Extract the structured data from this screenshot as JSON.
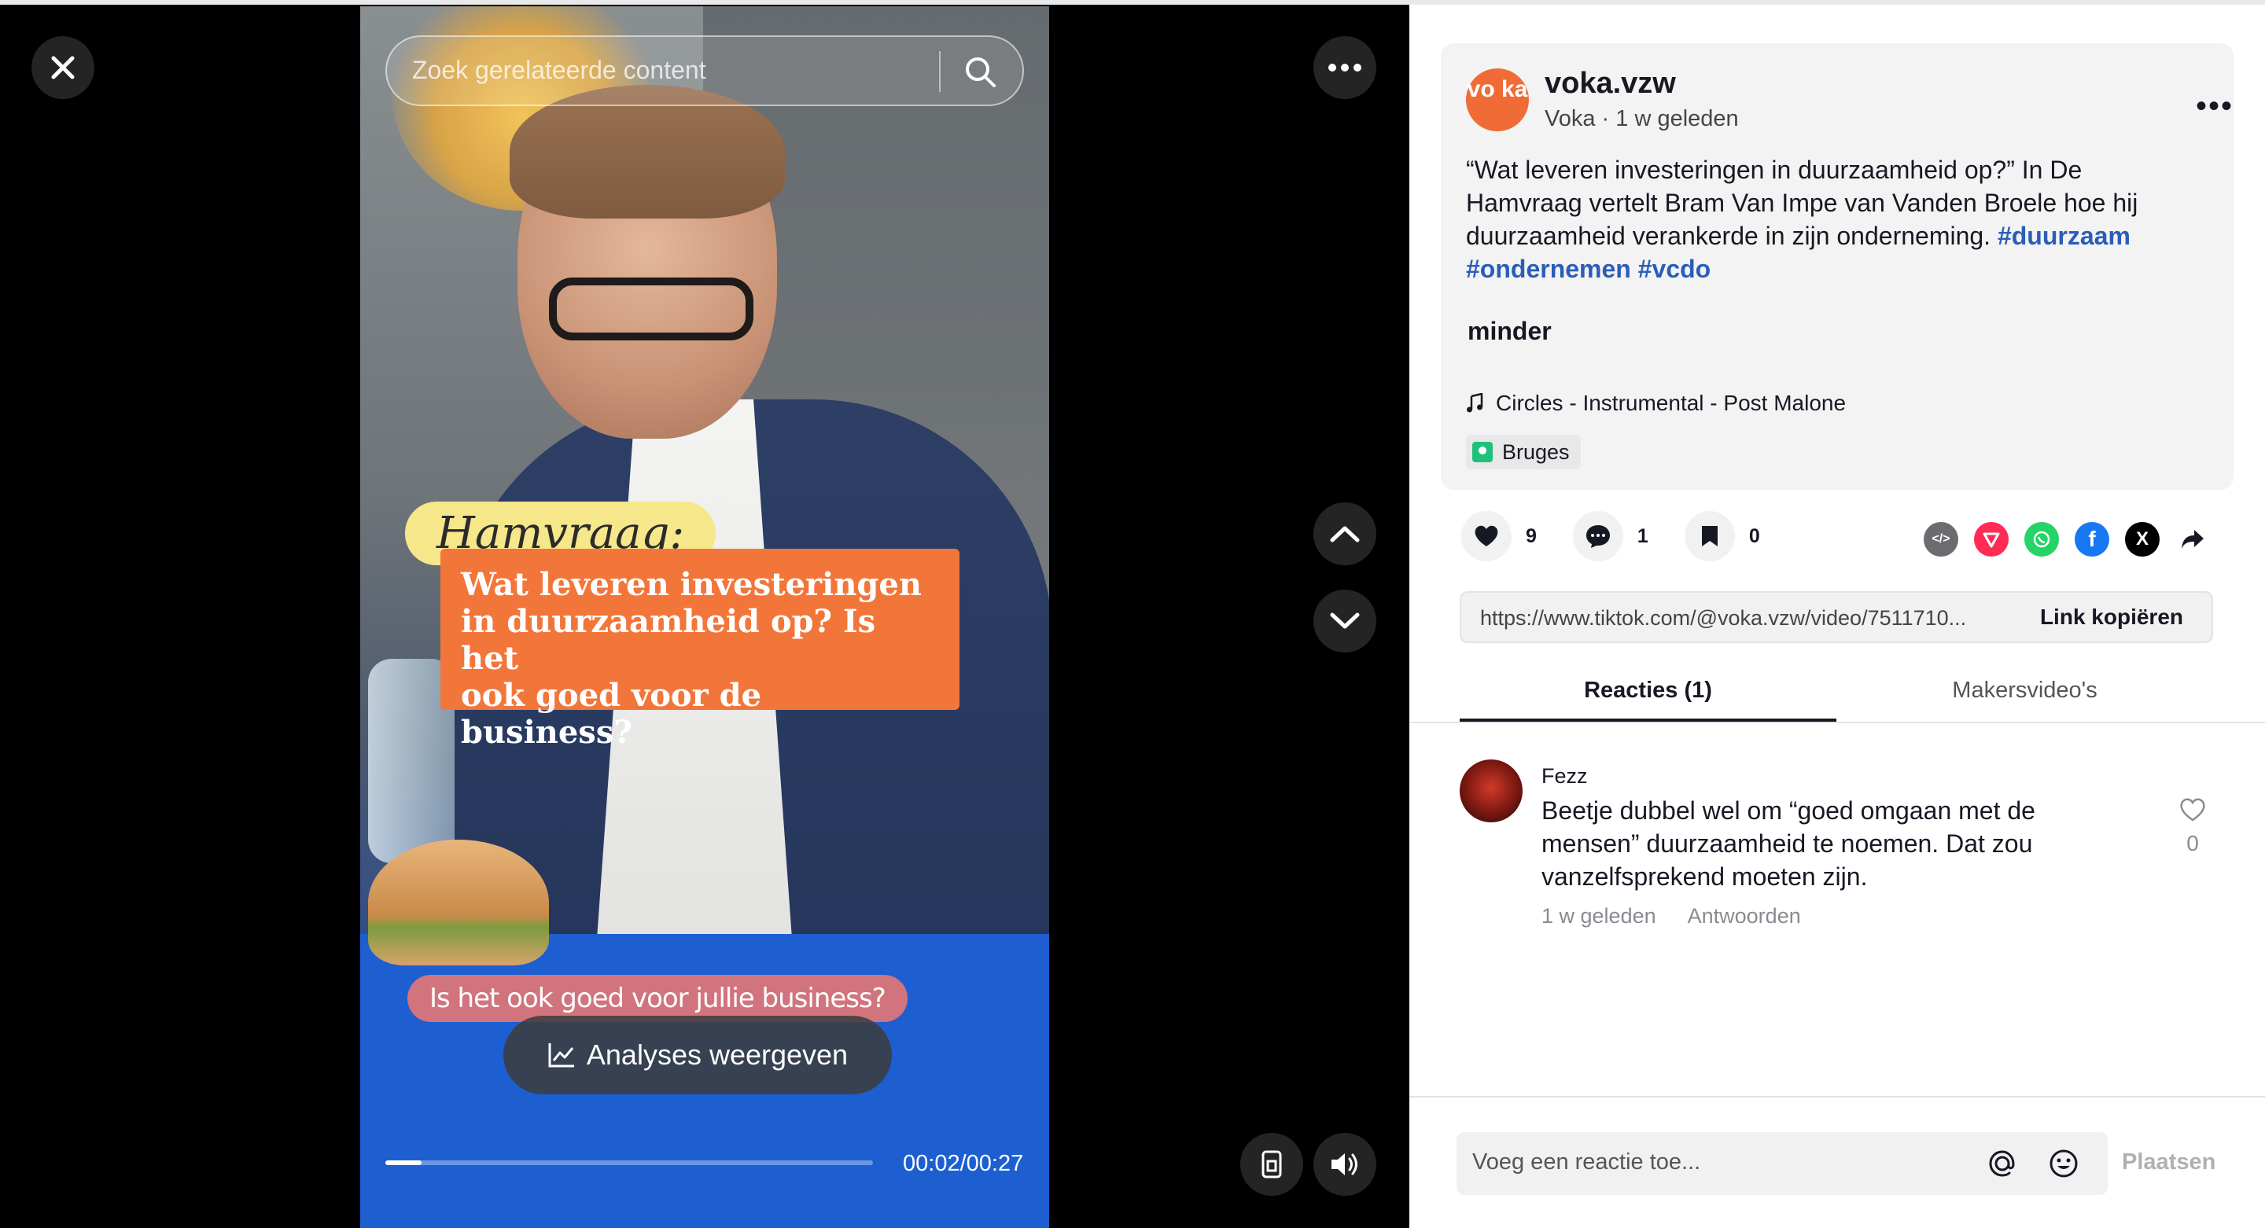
{
  "video": {
    "search_placeholder": "Zoek gerelateerde content",
    "overlay_title": "Hamvraag:",
    "overlay_question_lines": [
      "Wat leveren investeringen",
      "in duurzaamheid op? Is het",
      "ook goed voor de business?"
    ],
    "subtitle": "Is het ook goed voor jullie business?",
    "analyses_label": "Analyses weergeven",
    "time": "00:02/00:27",
    "progress_fraction": 0.074
  },
  "post": {
    "avatar_text": "vo ka",
    "author": "voka.vzw",
    "meta": "Voka · 1 w geleden",
    "description": "“Wat leveren investeringen in duurzaamheid op?” In De Hamvraag vertelt Bram Van Impe van Vanden Broele hoe hij duurzaamheid verankerde in zijn onderneming. ",
    "hashtags": [
      "#duurzaam",
      "#ondernemen",
      "#vcdo"
    ],
    "less_label": "minder",
    "music": "Circles - Instrumental - Post Malone",
    "location": "Bruges"
  },
  "actions": {
    "likes": "9",
    "comments": "1",
    "saves": "0"
  },
  "share": {
    "url": "https://www.tiktok.com/@voka.vzw/video/7511710...",
    "copy_label": "Link kopiëren"
  },
  "tabs": {
    "comments": "Reacties (1)",
    "creator_videos": "Makersvideo's"
  },
  "comment": {
    "author": "Fezz",
    "text": "Beetje dubbel wel om “goed omgaan met de mensen” duurzaamheid te noemen. Dat zou vanzelfsprekend moeten zijn.",
    "time": "1 w geleden",
    "reply_label": "Antwoorden",
    "likes": "0"
  },
  "composer": {
    "placeholder": "Voeg een reactie toe...",
    "post_label": "Plaatsen"
  },
  "colors": {
    "accent_orange": "#f06b36",
    "hashtag_blue": "#2b5db9",
    "pinterest_red": "#fe2c55",
    "whatsapp_green": "#25d366",
    "facebook_blue": "#1877f2"
  }
}
